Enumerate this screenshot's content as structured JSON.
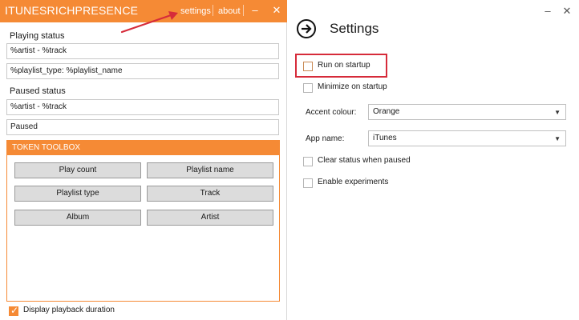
{
  "main_window": {
    "title": "ITUNESRICHPRESENCE",
    "links": {
      "settings": "settings",
      "about": "about"
    },
    "minimize_glyph": "‒",
    "close_glyph": "✕",
    "playing_status": {
      "label": "Playing status",
      "line1": "%artist - %track",
      "line2": "%playlist_type: %playlist_name"
    },
    "paused_status": {
      "label": "Paused status",
      "line1": "%artist - %track",
      "line2": "Paused"
    },
    "token_toolbox": {
      "header": "TOKEN TOOLBOX",
      "buttons": [
        "Play count",
        "Playlist name",
        "Playlist type",
        "Track",
        "Album",
        "Artist"
      ]
    },
    "display_playback_duration": {
      "label": "Display playback duration",
      "checked": true
    }
  },
  "settings_panel": {
    "title": "Settings",
    "back_icon": "arrow-right-circle-icon",
    "minimize_glyph": "‒",
    "close_glyph": "✕",
    "run_on_startup": {
      "label": "Run on startup",
      "checked": false
    },
    "minimize_on_startup": {
      "label": "Minimize on startup",
      "checked": false
    },
    "accent_colour": {
      "label": "Accent colour:",
      "value": "Orange"
    },
    "app_name": {
      "label": "App name:",
      "value": "iTunes"
    },
    "clear_status_when_paused": {
      "label": "Clear status when paused",
      "checked": false
    },
    "enable_experiments": {
      "label": "Enable experiments",
      "checked": false
    }
  },
  "colors": {
    "accent": "#f58a35",
    "annotation": "#d62b3a"
  }
}
